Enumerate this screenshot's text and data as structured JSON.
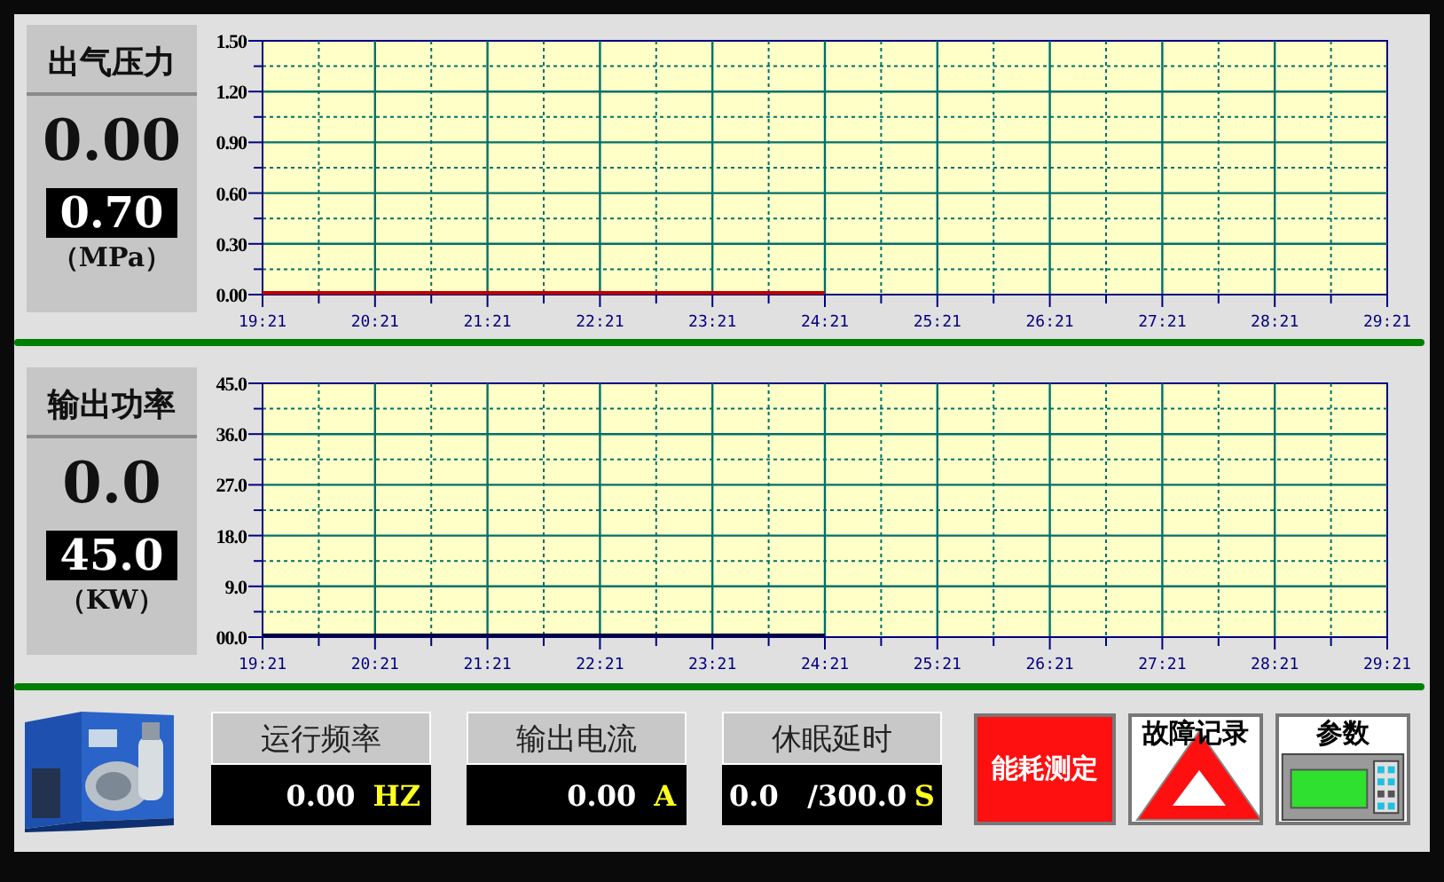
{
  "trends": [
    {
      "label": "出气压力",
      "value": "0.00",
      "setpoint": "0.70",
      "unit": "（MPa）",
      "chart_data": {
        "type": "line",
        "grid": true,
        "x": [
          "19:21",
          "20:21",
          "21:21",
          "22:21",
          "23:21",
          "24:21",
          "25:21",
          "26:21",
          "27:21",
          "28:21",
          "29:21"
        ],
        "ylim": [
          0,
          1.5
        ],
        "yticks": [
          {
            "value": 0,
            "label": "0.00"
          },
          {
            "value": 0.3,
            "label": "0.30"
          },
          {
            "value": 0.6,
            "label": "0.60"
          },
          {
            "value": 0.9,
            "label": "0.90"
          },
          {
            "value": 1.2,
            "label": "1.20"
          },
          {
            "value": 1.5,
            "label": "1.50"
          }
        ],
        "series": [
          {
            "color": "#c00000",
            "values": [
              0,
              0,
              0,
              0,
              0,
              0,
              null,
              null,
              null,
              null,
              null
            ]
          }
        ]
      }
    },
    {
      "label": "输出功率",
      "value": "0.0",
      "setpoint": "45.0",
      "unit": "（KW）",
      "chart_data": {
        "type": "line",
        "grid": true,
        "x": [
          "19:21",
          "20:21",
          "21:21",
          "22:21",
          "23:21",
          "24:21",
          "25:21",
          "26:21",
          "27:21",
          "28:21",
          "29:21"
        ],
        "ylim": [
          0,
          45
        ],
        "yticks": [
          {
            "value": 0,
            "label": "00.0"
          },
          {
            "value": 9,
            "label": "9.0"
          },
          {
            "value": 18,
            "label": "18.0"
          },
          {
            "value": 27,
            "label": "27.0"
          },
          {
            "value": 36,
            "label": "36.0"
          },
          {
            "value": 45,
            "label": "45.0"
          }
        ],
        "series": [
          {
            "color": "#000040",
            "values": [
              0,
              0,
              0,
              0,
              0,
              0,
              null,
              null,
              null,
              null,
              null
            ]
          }
        ]
      }
    }
  ],
  "readouts": [
    {
      "label": "运行频率",
      "value": "0.00",
      "unit": "HZ"
    },
    {
      "label": "输出电流",
      "value": "0.00",
      "unit": "A"
    },
    {
      "label": "休眠延时",
      "value": "0.0",
      "limit": "/300.0",
      "unit": "S"
    }
  ],
  "buttons": [
    {
      "kind": "energy",
      "label": "能耗测定"
    },
    {
      "kind": "fault",
      "label": "故障记录"
    },
    {
      "kind": "params",
      "label": "参数"
    }
  ]
}
